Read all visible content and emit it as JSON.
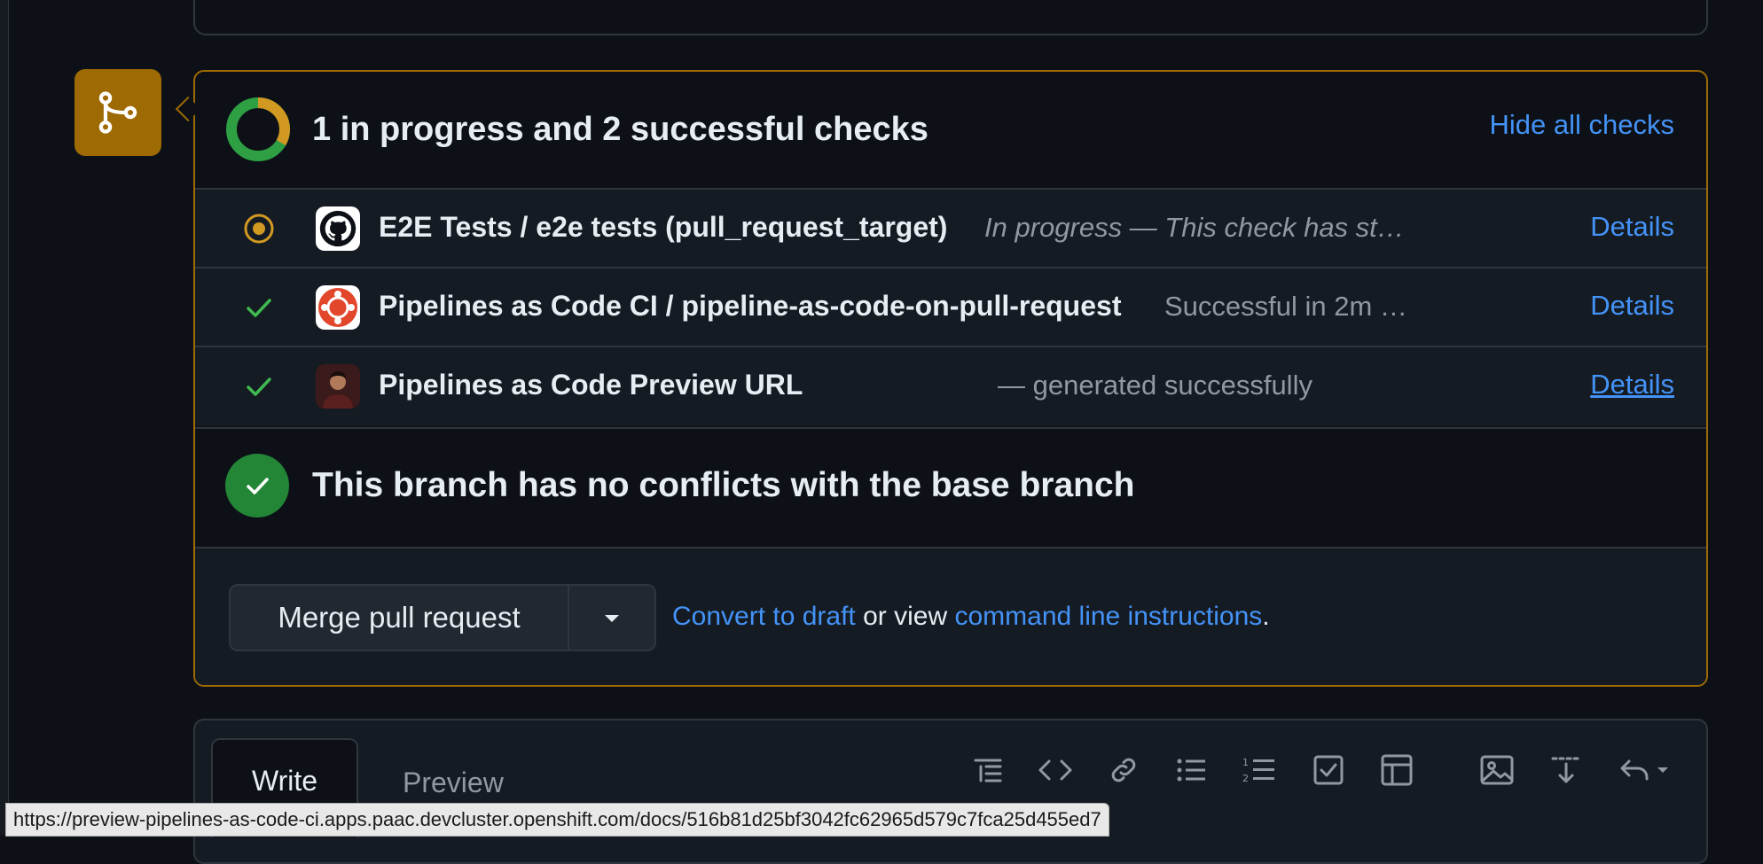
{
  "checks": {
    "summary": "1 in progress and 2 successful checks",
    "hide_label": "Hide all checks",
    "progress": {
      "in_progress": 1,
      "successful": 2
    },
    "items": [
      {
        "name": "E2E Tests / e2e tests (pull_request_target)",
        "description": "In progress — This check has st…",
        "details": "Details",
        "status": "in-progress",
        "app_icon": "github-icon"
      },
      {
        "name": "Pipelines as Code CI / pipeline-as-code-on-pull-request",
        "description": "Successful in 2m …",
        "details": "Details",
        "status": "success",
        "app_icon": "pipelines-icon"
      },
      {
        "name": "Pipelines as Code Preview URL",
        "description": "— generated successfully",
        "details": "Details",
        "status": "success",
        "app_icon": "avatar-icon"
      }
    ]
  },
  "conflicts": {
    "text": "This branch has no conflicts with the base branch"
  },
  "merge": {
    "button_label": "Merge pull request",
    "convert_link": "Convert to draft",
    "or_view": " or view ",
    "cli_link": "command line instructions",
    "period": "."
  },
  "editor": {
    "tab_write": "Write",
    "tab_preview": "Preview"
  },
  "status_url": "https://preview-pipelines-as-code-ci.apps.paac.devcluster.openshift.com/docs/516b81d25bf3042fc62965d579c7fca25d455ed7",
  "colors": {
    "accent": "#4493f8",
    "success": "#238636",
    "pending": "#d29922",
    "merge_badge": "#9e6a03"
  }
}
